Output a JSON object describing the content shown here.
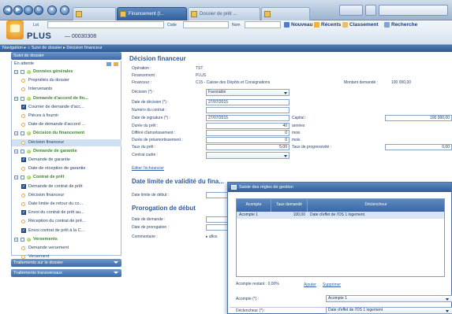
{
  "browser": {
    "tabs": [
      {
        "label": ""
      },
      {
        "label": "Financement (I..."
      },
      {
        "label": "Dossier de prêt ..."
      },
      {
        "label": ""
      }
    ]
  },
  "header": {
    "field_labels": [
      "Lot",
      "Code",
      "Nom"
    ],
    "product_name": "PLUS",
    "dossier_number": "— 00030308",
    "links": [
      "Nouveau",
      "Récents",
      "Classement",
      "Recherche"
    ],
    "accent": "#2e5b99"
  },
  "breadcrumb": {
    "nav_label": "Navigation",
    "items": [
      "Suivi de dossier",
      "Décision financeur"
    ]
  },
  "left": {
    "panel_title": "Suivi de dossier",
    "filter_label": "En attente",
    "tree": [
      {
        "type": "section",
        "label": "Données générales"
      },
      {
        "type": "item",
        "label": "Propriétés du dossier"
      },
      {
        "type": "item",
        "label": "Intervenants"
      },
      {
        "type": "section",
        "label": "Demande d'accord de fin..."
      },
      {
        "type": "check",
        "label": "Courrier de demande d'acc..."
      },
      {
        "type": "item",
        "label": "Pièces à fournir"
      },
      {
        "type": "item",
        "label": "Date de demande d'accord ..."
      },
      {
        "type": "section",
        "label": "Décision du financement"
      },
      {
        "type": "item",
        "label": "Décision financeur",
        "selected": true
      },
      {
        "type": "section",
        "label": "Demande de garantie"
      },
      {
        "type": "check",
        "label": "Demande de garantie"
      },
      {
        "type": "item",
        "label": "Date de réception de garantie"
      },
      {
        "type": "section",
        "label": "Contrat de prêt"
      },
      {
        "type": "check",
        "label": "Demande de contrat de prêt"
      },
      {
        "type": "item",
        "label": "Décision financeur"
      },
      {
        "type": "item",
        "label": "Date limite de retour du co..."
      },
      {
        "type": "check",
        "label": "Envoi du contrat de prêt au..."
      },
      {
        "type": "item",
        "label": "Réception du contrat de prê..."
      },
      {
        "type": "check",
        "label": "Envoi contrat de prêt à la C..."
      },
      {
        "type": "section",
        "label": "Versements"
      },
      {
        "type": "item",
        "label": "Demande versement"
      },
      {
        "type": "item",
        "label": "Versement"
      }
    ],
    "bottom_panels": [
      "Traitements sur le dossier",
      "Traitements transversaux"
    ]
  },
  "form": {
    "title": "Décision financeur",
    "operation_label": "Opération :",
    "operation_value": "TST",
    "financement_label": "Financement :",
    "financement_value": "PLUS",
    "financeur_label": "Financeur :",
    "financeur_value": "C15 - Caisse des Dépôts et Consignations",
    "montant_demande_label": "Montant demandé :",
    "montant_demande_value": "100 000,00",
    "decision_label": "Décision (*) :",
    "decision_value": "Favorable",
    "date_decision_label": "Date de décision (*) :",
    "date_decision_value": "27/07/2015",
    "numero_contrat_label": "Numéro du contrat :",
    "numero_contrat_value": "",
    "date_signature_label": "Date de signature (*) :",
    "date_signature_value": "27/07/2015",
    "capital_label": "Capital :",
    "capital_value": "100 000,00",
    "duree_pret_label": "Durée du prêt :",
    "duree_pret_value": "40",
    "duree_pret_unit": "années",
    "differe_label": "Différé d'amortissement :",
    "differe_value": "0",
    "differe_unit": "mois",
    "preamortissement_label": "Durée de préamortissement :",
    "preamortissement_value": "0",
    "preamortissement_unit": "mois",
    "taux_label": "Taux du prêt :",
    "taux_value": "5,00",
    "taux_progressivite_label": "Taux de progressivité :",
    "taux_progressivite_value": "0,00",
    "contrat_cadre_label": "Contrat cadre :",
    "contrat_cadre_value": "",
    "edit_link": "Éditer l'échéancier",
    "section_date_limite": "Date limite de validité du fina...",
    "date_limite_debut_label": "Date limite de début :",
    "section_prorogation": "Prorogation de début",
    "date_demande_label": "Date de demande :",
    "date_prorogation_label": "Date de prorogation :",
    "commentaire_label": "Commentaire :",
    "commentaire_value": "▸ aflos"
  },
  "popup": {
    "title": "Saisie des règles de gestion",
    "columns": [
      "Acompte",
      "Taux demandé",
      "Déclencheur"
    ],
    "rows": [
      {
        "acompte": "Acompte 1",
        "taux": "100,00",
        "declencheur": "Date d'effet de l'OS 1 logement"
      }
    ],
    "acompte_restant_label": "Acompte restant : 0,00%",
    "ajouter_label": "Ajouter",
    "supprimer_label": "Supprimer",
    "acompte_field_label": "Acompte (*) :",
    "acompte_field_value": "Acompte 1",
    "declencheur_field_label": "Déclencheur (*) :",
    "declencheur_field_value": "Date d'effet de l'OS 1 logement"
  }
}
